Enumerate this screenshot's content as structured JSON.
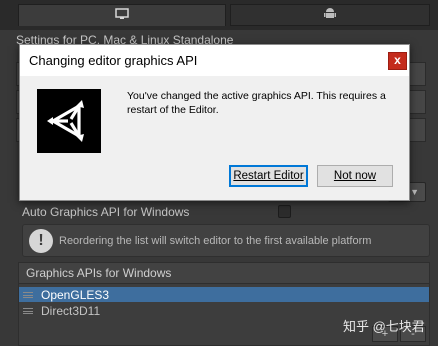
{
  "background": {
    "platform_tabs": [
      {
        "icon": "monitor-icon",
        "glyph": "🖵"
      },
      {
        "icon": "android-icon",
        "glyph": "🤖"
      }
    ],
    "settings_title": "Settings for PC, Mac & Linux Standalone",
    "dropdown_arrow": "▼",
    "auto_graphics_label": "Auto Graphics API  for Windows",
    "info_icon_glyph": "!",
    "info_message": "Reordering the list will switch editor to the first available platform",
    "graphics_apis_header": "Graphics APIs for Windows",
    "graphics_apis": [
      "OpenGLES3",
      "Direct3D11"
    ],
    "list_add_label": "+",
    "list_remove_label": "-",
    "watermark": "知乎 @七块君"
  },
  "dialog": {
    "title": "Changing editor graphics API",
    "close_label": "x",
    "logo_icon": "unity-logo-icon",
    "message": "You've changed the active graphics API. This requires a restart of the Editor.",
    "restart_label": "Restart Editor",
    "not_now_label": "Not now"
  },
  "colors": {
    "selection": "#3e6e9e",
    "close_button": "#c42b1c",
    "default_button_border": "#0078d7"
  }
}
